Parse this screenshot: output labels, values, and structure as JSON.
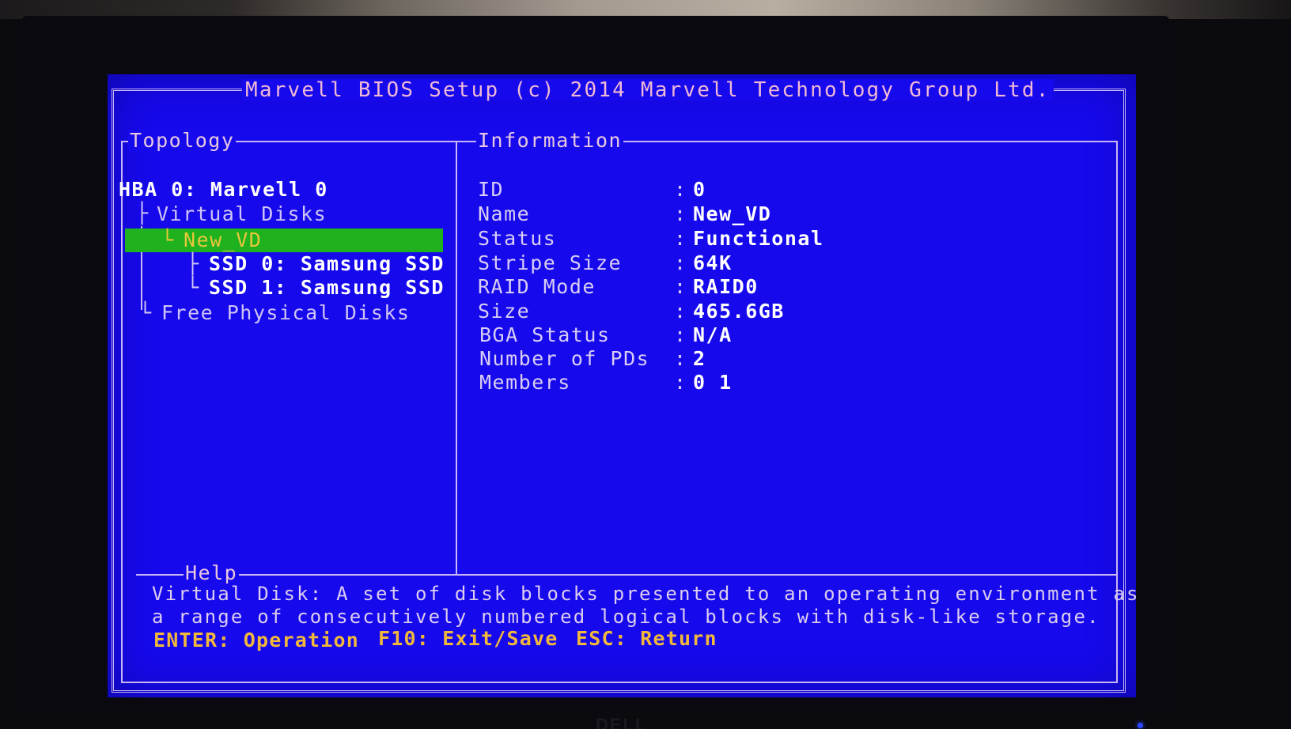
{
  "bios": {
    "title": "Marvell BIOS Setup (c) 2014 Marvell Technology Group Ltd.",
    "topology": {
      "label": "Topology",
      "hba": "HBA 0: Marvell 0",
      "virtual_disks": "Virtual Disks",
      "selected_vd": "New_VD",
      "ssd0": "SSD 0: Samsung SSD",
      "ssd1": "SSD 1: Samsung SSD",
      "free_disks": "Free Physical Disks"
    },
    "information": {
      "label": "Information",
      "rows": [
        {
          "label": "ID",
          "value": "0"
        },
        {
          "label": "Name",
          "value": "New_VD"
        },
        {
          "label": "Status",
          "value": "Functional"
        },
        {
          "label": "Stripe Size",
          "value": "64K"
        },
        {
          "label": "RAID Mode",
          "value": "RAID0"
        },
        {
          "label": "Size",
          "value": "465.6GB"
        },
        {
          "label": "BGA Status",
          "value": "N/A"
        },
        {
          "label": "Number of PDs",
          "value": "2"
        },
        {
          "label": "Members",
          "value": "0 1"
        }
      ]
    },
    "help": {
      "label": "Help",
      "line1": "Virtual Disk: A set of disk blocks presented to an operating environment as",
      "line2": "a range of consecutively numbered logical blocks with disk-like storage.",
      "keys": {
        "enter": "ENTER: Operation",
        "f10": "F10: Exit/Save",
        "esc": "ESC: Return"
      }
    }
  },
  "monitor": {
    "brand": "DELL"
  },
  "colors": {
    "screen_bg": "#1609ec",
    "frame": "#c8b6f4",
    "selection": "#1fb21e",
    "selection_text": "#e8c63a",
    "key_text": "#f2b83a",
    "value_text": "#ffffff"
  }
}
